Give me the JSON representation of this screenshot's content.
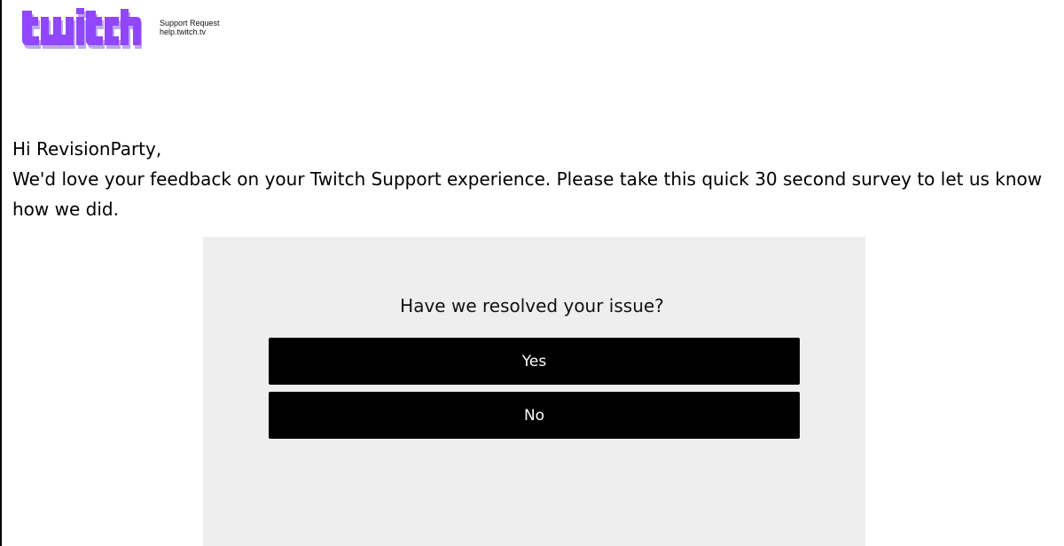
{
  "brand": {
    "logo_text": "twitch",
    "primary_color": "#9146ff",
    "shadow_color": "#bca7ef"
  },
  "header": {
    "title": "Support Request",
    "url": "help.twitch.tv"
  },
  "message": {
    "greeting": "Hi RevisionParty,",
    "body": "We'd love your feedback on your Twitch Support experience. Please take this quick 30 second survey to let us know how we did."
  },
  "survey": {
    "question": "Have we resolved your issue?",
    "panel_color": "#eeeeee",
    "buttons": [
      {
        "label": "Yes"
      },
      {
        "label": "No"
      }
    ]
  }
}
